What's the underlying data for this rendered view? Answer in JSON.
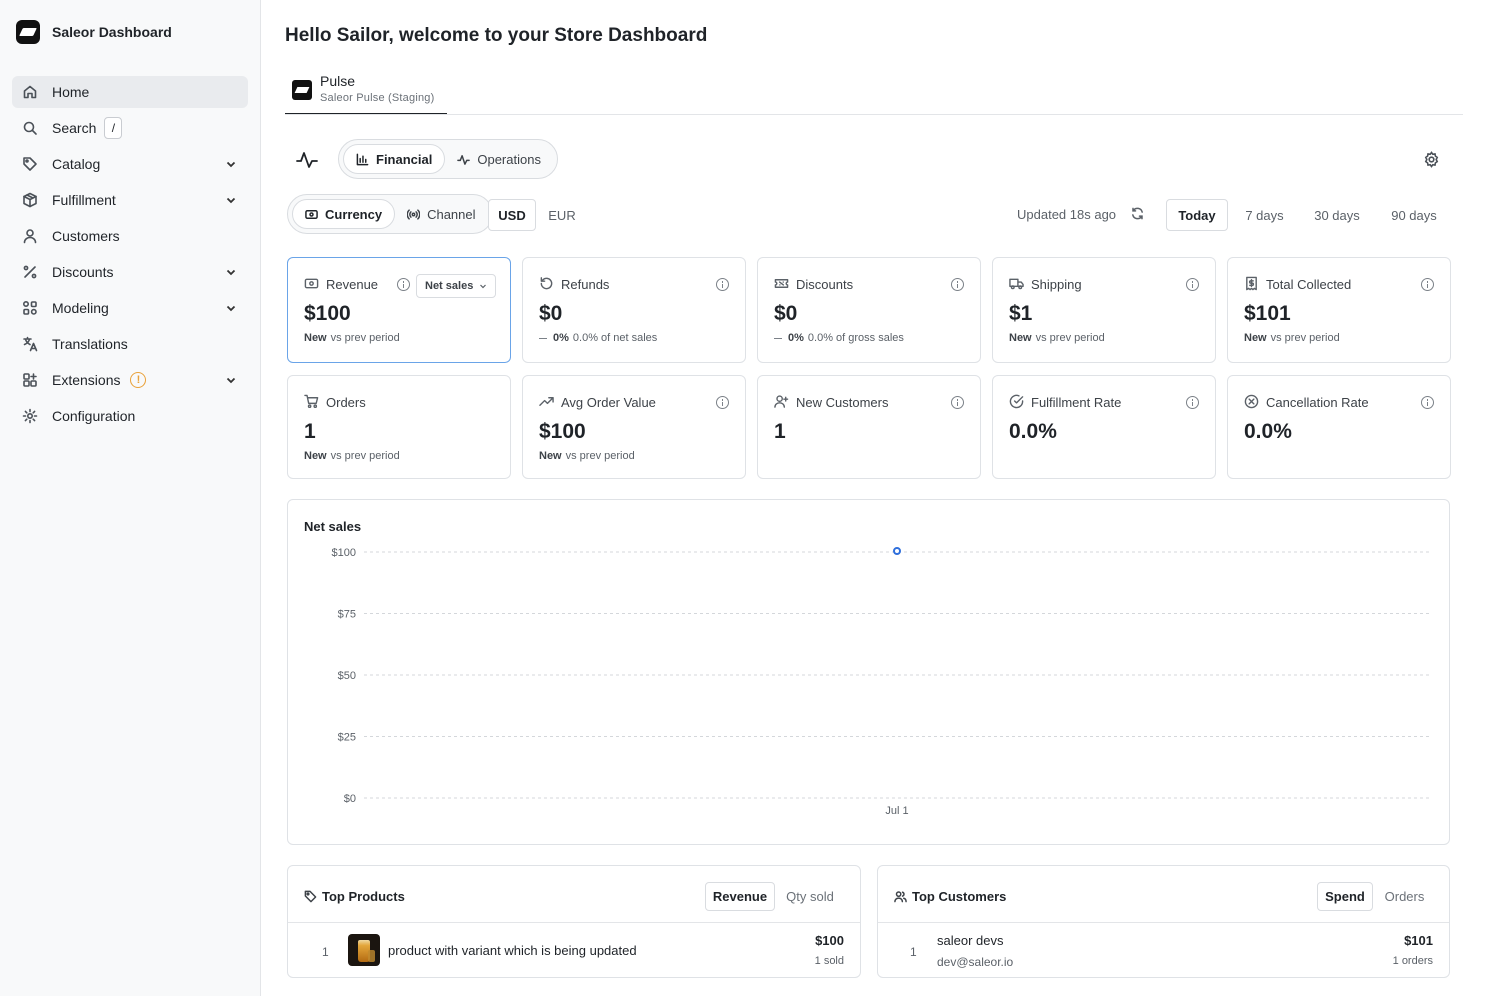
{
  "sidebar": {
    "brand": "Saleor Dashboard",
    "search_shortcut": "/",
    "items": [
      {
        "label": "Home"
      },
      {
        "label": "Search"
      },
      {
        "label": "Catalog"
      },
      {
        "label": "Fulfillment"
      },
      {
        "label": "Customers"
      },
      {
        "label": "Discounts"
      },
      {
        "label": "Modeling"
      },
      {
        "label": "Translations"
      },
      {
        "label": "Extensions",
        "badge": "!"
      },
      {
        "label": "Configuration"
      }
    ]
  },
  "header": {
    "title": "Hello Sailor, welcome to your Store Dashboard",
    "app_tab": {
      "name": "Pulse",
      "subtitle": "Saleor Pulse (Staging)"
    }
  },
  "view_tabs": {
    "financial": "Financial",
    "operations": "Operations"
  },
  "group_by": {
    "currency": "Currency",
    "channel": "Channel"
  },
  "currencies": {
    "usd": "USD",
    "eur": "EUR"
  },
  "status": {
    "updated": "Updated 18s ago"
  },
  "periods": {
    "today": "Today",
    "d7": "7 days",
    "d30": "30 days",
    "d90": "90 days"
  },
  "kpis": {
    "revenue": {
      "label": "Revenue",
      "metric": "Net sales",
      "value": "$100",
      "change": "New",
      "note": "vs prev period"
    },
    "refunds": {
      "label": "Refunds",
      "value": "$0",
      "change": "0%",
      "note": "0.0% of net sales"
    },
    "discounts": {
      "label": "Discounts",
      "value": "$0",
      "change": "0%",
      "note": "0.0% of gross sales"
    },
    "shipping": {
      "label": "Shipping",
      "value": "$1",
      "change": "New",
      "note": "vs prev period"
    },
    "total_collected": {
      "label": "Total Collected",
      "value": "$101",
      "change": "New",
      "note": "vs prev period"
    },
    "orders": {
      "label": "Orders",
      "value": "1",
      "change": "New",
      "note": "vs prev period"
    },
    "avg_order_value": {
      "label": "Avg Order Value",
      "value": "$100",
      "change": "New",
      "note": "vs prev period"
    },
    "new_customers": {
      "label": "New Customers",
      "value": "1"
    },
    "fulfillment_rate": {
      "label": "Fulfillment Rate",
      "value": "0.0%"
    },
    "cancellation_rate": {
      "label": "Cancellation Rate",
      "value": "0.0%"
    }
  },
  "chart_data": {
    "type": "line",
    "title": "Net sales",
    "categories": [
      "Jul 1"
    ],
    "series": [
      {
        "values": [
          100
        ]
      }
    ],
    "y_ticks": [
      "$0",
      "$25",
      "$50",
      "$75",
      "$100"
    ],
    "ylim": [
      0,
      100
    ],
    "grid": true,
    "point_color": "#2f6fdc"
  },
  "top_products": {
    "title": "Top Products",
    "toggle": {
      "revenue": "Revenue",
      "qty": "Qty sold"
    },
    "rows": [
      {
        "rank": "1",
        "name": "product with variant which is being updated",
        "amount": "$100",
        "meta": "1 sold"
      }
    ]
  },
  "top_customers": {
    "title": "Top Customers",
    "toggle": {
      "spend": "Spend",
      "orders": "Orders"
    },
    "rows": [
      {
        "rank": "1",
        "name": "saleor devs",
        "email": "dev@saleor.io",
        "amount": "$101",
        "meta": "1 orders"
      }
    ]
  }
}
